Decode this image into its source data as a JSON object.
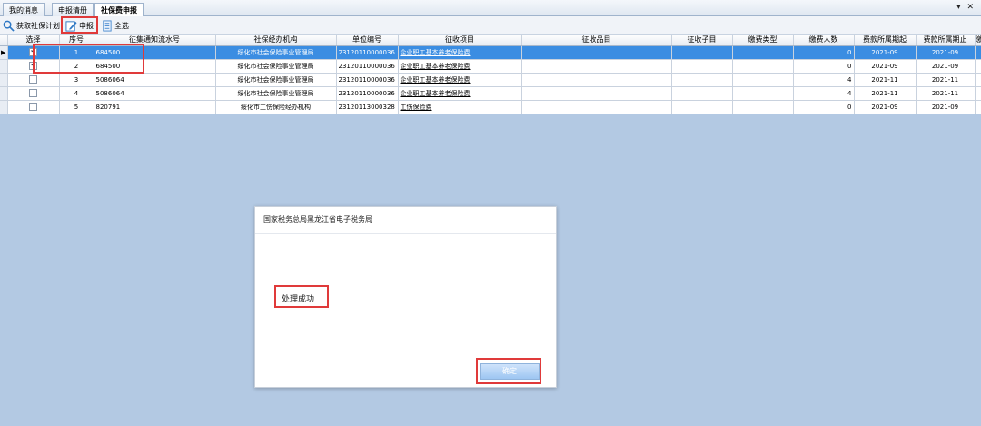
{
  "tabs": [
    {
      "label": "我的消息",
      "active": false
    },
    {
      "label": "申报清册",
      "active": false
    },
    {
      "label": "社保费申报",
      "active": true
    }
  ],
  "window_controls": "▾ ✕",
  "toolbar": {
    "fetch_label": "获取社保计划",
    "declare_label": "申报",
    "select_all_label": "全选"
  },
  "table": {
    "columns": [
      "选择",
      "序号",
      "征集通知流水号",
      "社保经办机构",
      "单位编号",
      "征收项目",
      "征收品目",
      "征收子目",
      "缴费类型",
      "缴费人数",
      "费款所属期起",
      "费款所属期止",
      "缴费基数"
    ],
    "rows": [
      {
        "checked": true,
        "seq": "1",
        "notice_no": "684500",
        "agency": "绥化市社会保险事业管理局",
        "unit_no": "23120110000036",
        "item": "企业职工基本养老保险费",
        "category": "",
        "subcategory": "",
        "pay_type": "",
        "count": "0",
        "period_start": "2021-09",
        "period_end": "2021-09",
        "base": ""
      },
      {
        "checked": true,
        "seq": "2",
        "notice_no": "684500",
        "agency": "绥化市社会保险事业管理局",
        "unit_no": "23120110000036",
        "item": "企业职工基本养老保险费",
        "category": "",
        "subcategory": "",
        "pay_type": "",
        "count": "0",
        "period_start": "2021-09",
        "period_end": "2021-09",
        "base": ""
      },
      {
        "checked": false,
        "seq": "3",
        "notice_no": "5086064",
        "agency": "绥化市社会保险事业管理局",
        "unit_no": "23120110000036",
        "item": "企业职工基本养老保险费",
        "category": "",
        "subcategory": "",
        "pay_type": "",
        "count": "4",
        "period_start": "2021-11",
        "period_end": "2021-11",
        "base": ""
      },
      {
        "checked": false,
        "seq": "4",
        "notice_no": "5086064",
        "agency": "绥化市社会保险事业管理局",
        "unit_no": "23120110000036",
        "item": "企业职工基本养老保险费",
        "category": "",
        "subcategory": "",
        "pay_type": "",
        "count": "4",
        "period_start": "2021-11",
        "period_end": "2021-11",
        "base": ""
      },
      {
        "checked": false,
        "seq": "5",
        "notice_no": "820791",
        "agency": "绥化市工伤保险经办机构",
        "unit_no": "23120113000328",
        "item": "工伤保险费",
        "category": "",
        "subcategory": "",
        "pay_type": "",
        "count": "0",
        "period_start": "2021-09",
        "period_end": "2021-09",
        "base": ""
      }
    ]
  },
  "dialog": {
    "title": "国家税务总局黑龙江省电子税务局",
    "message": "处理成功",
    "ok_label": "确定"
  },
  "colors": {
    "selection": "#3b8de2",
    "workspace": "#b3c9e3",
    "highlight": "#e03a3a"
  }
}
